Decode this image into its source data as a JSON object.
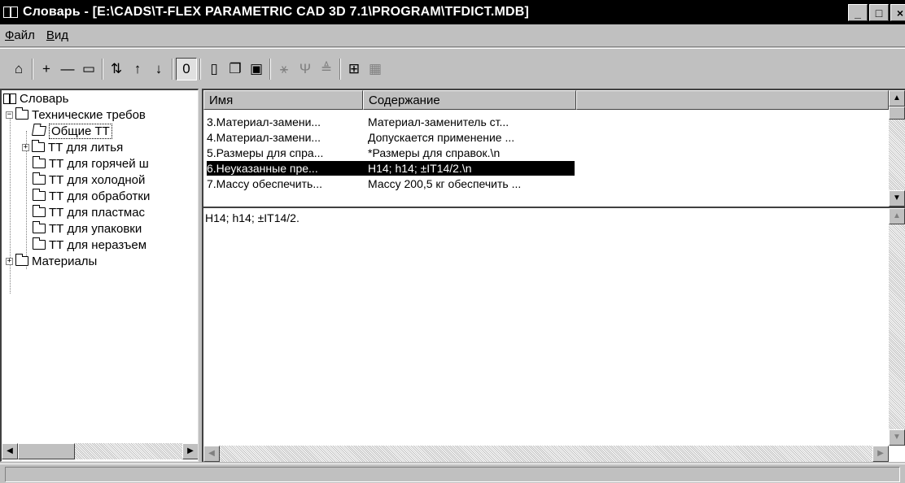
{
  "window": {
    "title": "Словарь - [E:\\CADS\\T-FLEX PARAMETRIC CAD 3D 7.1\\PROGRAM\\TFDICT.MDB]",
    "minimize_label": "_",
    "maximize_label": "□",
    "close_label": "×"
  },
  "menu": {
    "file": {
      "first": "Ф",
      "rest": "айл"
    },
    "view": {
      "first": "В",
      "rest": "ид"
    }
  },
  "toolbar": {
    "buttons": [
      {
        "icon": "open-folder-icon",
        "glyph": "⌂"
      },
      {
        "icon": "plus-icon",
        "glyph": "+"
      },
      {
        "icon": "minus-icon",
        "glyph": "—"
      },
      {
        "icon": "properties-icon",
        "glyph": "▭"
      },
      {
        "icon": "sort-az-icon",
        "glyph": "⇅"
      },
      {
        "icon": "arrow-up-icon",
        "glyph": "↑"
      },
      {
        "icon": "arrow-down-icon",
        "glyph": "↓"
      },
      {
        "icon": "paperclip-icon",
        "glyph": "0"
      },
      {
        "icon": "book-icon",
        "glyph": "▯"
      },
      {
        "icon": "copy-icon",
        "glyph": "❐"
      },
      {
        "icon": "paste-icon",
        "glyph": "▣"
      },
      {
        "icon": "symbol-icon",
        "glyph": "⚹"
      },
      {
        "icon": "tolerance-icon",
        "glyph": "Ψ"
      },
      {
        "icon": "roughness-icon",
        "glyph": "≜"
      },
      {
        "icon": "table-icon",
        "glyph": "⊞"
      },
      {
        "icon": "grid-icon",
        "glyph": "▦"
      }
    ]
  },
  "tree": {
    "root": "Словарь",
    "items": [
      {
        "label": "Технические требов",
        "level": 1,
        "expander": "−"
      },
      {
        "label": "Общие ТТ",
        "level": 2,
        "selected": true
      },
      {
        "label": "ТТ для литья",
        "level": 2,
        "expander": "+"
      },
      {
        "label": "ТТ для горячей ш",
        "level": 2
      },
      {
        "label": "ТТ для холодной",
        "level": 2
      },
      {
        "label": "ТТ для обработки",
        "level": 2
      },
      {
        "label": "ТТ для пластмас",
        "level": 2
      },
      {
        "label": "ТТ для упаковки",
        "level": 2
      },
      {
        "label": "ТТ для неразъем",
        "level": 2
      },
      {
        "label": "Материалы",
        "level": 1,
        "expander": "+"
      }
    ]
  },
  "list": {
    "columns": [
      "Имя",
      "Содержание",
      ""
    ],
    "rows": [
      {
        "name": "3.Материал-замени...",
        "content": "Материал-заменитель ст..."
      },
      {
        "name": "4.Материал-замени...",
        "content": "Допускается применение ..."
      },
      {
        "name": "5.Размеры для спра...",
        "content": "*Размеры для справок.\\n"
      },
      {
        "name": "6.Неуказанные пре...",
        "content": "H14; h14; ±IT14/2.\\n",
        "selected": true
      },
      {
        "name": "7.Массу обеспечить...",
        "content": "Массу 200,5 кг обеспечить ..."
      }
    ]
  },
  "detail": {
    "text": "H14; h14; ±IT14/2."
  },
  "scroll": {
    "up": "▲",
    "down": "▼",
    "left": "◀",
    "right": "▶"
  },
  "colors": {
    "face": "#c0c0c0",
    "titlebar": "#000000",
    "selection": "#000000",
    "window": "#ffffff"
  }
}
